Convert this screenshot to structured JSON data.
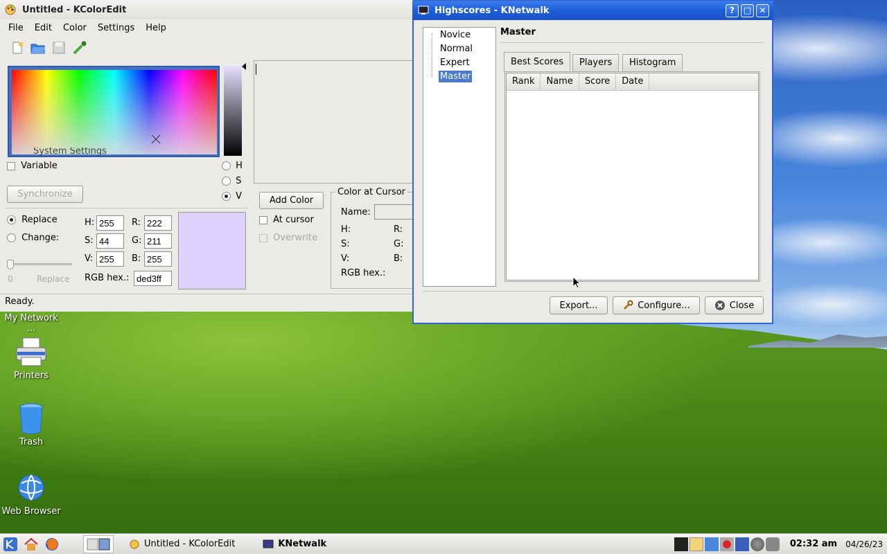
{
  "desktop": {
    "icons": [
      {
        "label": "My Network ..."
      },
      {
        "label": "Printers"
      },
      {
        "label": "Trash"
      },
      {
        "label": "Web Browser"
      }
    ]
  },
  "kcoloredit": {
    "title": "Untitled - KColorEdit",
    "menu": [
      "File",
      "Edit",
      "Color",
      "Settings",
      "Help"
    ],
    "hidden_text": "System Settings",
    "variable_label": "Variable",
    "synchronize_label": "Synchronize",
    "hsv_radios": [
      "H",
      "S",
      "V"
    ],
    "hsv_selected": "V",
    "replace_label": "Replace",
    "change_label": "Change:",
    "slider_min": "0",
    "slider_label": "Replace",
    "h_label": "H:",
    "h_value": "255",
    "s_label": "S:",
    "s_value": "44",
    "v_label": "V:",
    "v_value": "255",
    "r_label": "R:",
    "r_value": "222",
    "g_label": "G:",
    "g_value": "211",
    "b_label": "B:",
    "b_value": "255",
    "rgbhex_label": "RGB hex.:",
    "rgbhex_value": "ded3ff",
    "current_color": "#ded3ff",
    "add_color_label": "Add Color",
    "at_cursor_label": "At cursor",
    "overwrite_label": "Overwrite",
    "color_at_cursor": {
      "title": "Color at Cursor",
      "name_label": "Name:",
      "h": "H:",
      "s": "S:",
      "v": "V:",
      "r": "R:",
      "g": "G:",
      "b": "B:",
      "rgbhex": "RGB hex.:"
    },
    "status": "Ready."
  },
  "highscores": {
    "title": "Highscores - KNetwalk",
    "levels": [
      "Novice",
      "Normal",
      "Expert",
      "Master"
    ],
    "selected_level": "Master",
    "heading": "Master",
    "tabs": [
      "Best Scores",
      "Players",
      "Histogram"
    ],
    "active_tab": "Best Scores",
    "columns": [
      "Rank",
      "Name",
      "Score",
      "Date"
    ],
    "rows": [],
    "export_label": "Export...",
    "configure_label": "Configure...",
    "close_label": "Close"
  },
  "taskbar": {
    "tasks": [
      {
        "label": "Untitled - KColorEdit"
      },
      {
        "label": "KNetwalk"
      }
    ],
    "clock": "02:32 am",
    "date": "04/26/23"
  }
}
